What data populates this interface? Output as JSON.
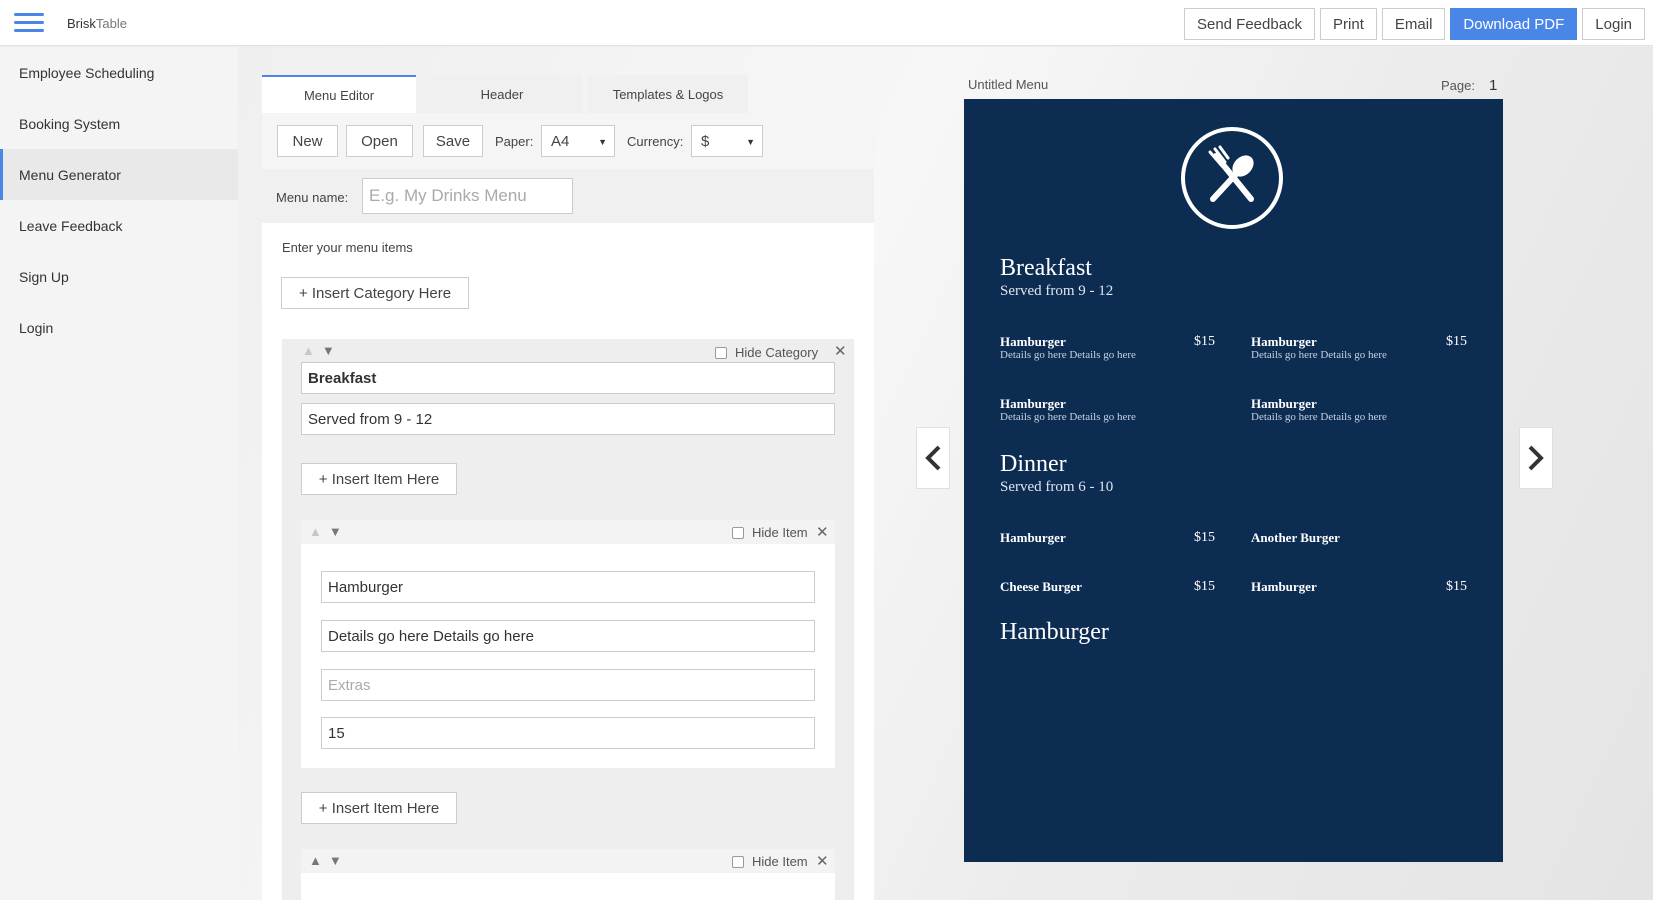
{
  "brand": {
    "part1": "Brisk",
    "part2": "Table"
  },
  "topbar": {
    "send_feedback": "Send Feedback",
    "print": "Print",
    "email": "Email",
    "download_pdf": "Download PDF",
    "login": "Login"
  },
  "sidebar": {
    "items": [
      {
        "label": "Employee Scheduling"
      },
      {
        "label": "Booking System"
      },
      {
        "label": "Menu Generator"
      },
      {
        "label": "Leave Feedback"
      },
      {
        "label": "Sign Up"
      },
      {
        "label": "Login"
      }
    ]
  },
  "tabs": [
    "Menu Editor",
    "Header",
    "Templates & Logos"
  ],
  "toolbar": {
    "new": "New",
    "open": "Open",
    "save": "Save",
    "paper_label": "Paper:",
    "paper_value": "A4",
    "currency_label": "Currency:",
    "currency_value": "$"
  },
  "menu_name": {
    "label": "Menu name:",
    "placeholder": "E.g. My Drinks Menu"
  },
  "editor": {
    "intro": "Enter your menu items",
    "insert_category": "+ Insert Category Here",
    "hide_category": "Hide Category",
    "category_name": "Breakfast",
    "category_sub": "Served from 9 - 12",
    "insert_item": "+ Insert Item Here",
    "hide_item": "Hide Item",
    "item": {
      "name": "Hamburger",
      "details": "Details go here Details go here",
      "extras_placeholder": "Extras",
      "price": "15"
    }
  },
  "preview": {
    "title": "Untitled Menu",
    "page_label": "Page:",
    "page_num": "1",
    "sections": [
      {
        "title": "Breakfast",
        "subtitle": "Served from 9 - 12",
        "items": [
          {
            "name": "Hamburger",
            "details": "Details go here Details go here",
            "price": "$15"
          },
          {
            "name": "Hamburger",
            "details": "Details go here Details go here",
            "price": "$15"
          },
          {
            "name": "Hamburger",
            "details": "Details go here Details go here",
            "price": ""
          },
          {
            "name": "Hamburger",
            "details": "Details go here Details go here",
            "price": ""
          }
        ]
      },
      {
        "title": "Dinner",
        "subtitle": "Served from 6 - 10",
        "items": [
          {
            "name": "Hamburger",
            "price": "$15"
          },
          {
            "name": "Another Burger",
            "price": ""
          },
          {
            "name": "Cheese Burger",
            "price": "$15"
          },
          {
            "name": "Hamburger",
            "price": "$15"
          }
        ]
      },
      {
        "title": "Hamburger"
      }
    ]
  },
  "colors": {
    "accent": "#4a86e8",
    "sheet": "#0d2c52"
  },
  "icons": [
    "menu-icon",
    "fork-spoon-logo-icon",
    "chevron-left-icon",
    "chevron-right-icon",
    "close-icon",
    "arrow-up-icon",
    "arrow-down-icon"
  ]
}
